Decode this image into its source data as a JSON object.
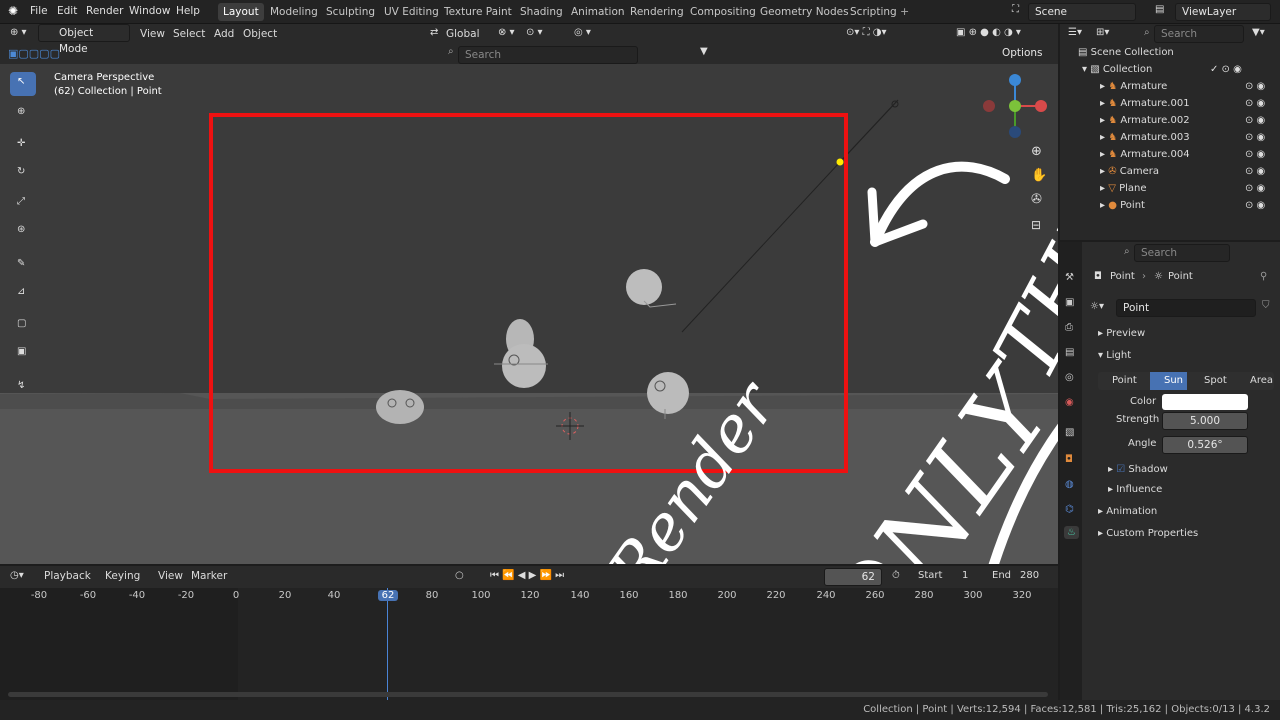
{
  "menus": [
    "File",
    "Edit",
    "Render",
    "Window",
    "Help"
  ],
  "workspaces": [
    "Layout",
    "Modeling",
    "Sculpting",
    "UV Editing",
    "Texture Paint",
    "Shading",
    "Animation",
    "Rendering",
    "Compositing",
    "Geometry Nodes",
    "Scripting"
  ],
  "active_workspace": "Layout",
  "scene": "Scene",
  "view_layer": "ViewLayer",
  "header": {
    "mode": "Object Mode",
    "view": "View",
    "select": "Select",
    "add": "Add",
    "object": "Object",
    "orientation": "Global",
    "search_placeholder": "Search",
    "options": "Options"
  },
  "viewport": {
    "title": "Camera Perspective",
    "subtitle": "(62) Collection | Point"
  },
  "annotation": {
    "text1": "Render",
    "text2": "ONLY",
    "text3": "THIS"
  },
  "outliner": {
    "search_placeholder": "Search",
    "scene_collection": "Scene Collection",
    "collection": "Collection",
    "items": [
      "Armature",
      "Armature.001",
      "Armature.002",
      "Armature.003",
      "Armature.004",
      "Camera",
      "Plane",
      "Point"
    ]
  },
  "properties": {
    "search_placeholder": "Search",
    "breadcrumb_obj": "Point",
    "breadcrumb_data": "Point",
    "datablock": "Point",
    "preview": "Preview",
    "light": "Light",
    "light_types": [
      "Point",
      "Sun",
      "Spot",
      "Area"
    ],
    "active_light_type": "Sun",
    "color_label": "Color",
    "strength_label": "Strength",
    "strength_value": "5.000",
    "angle_label": "Angle",
    "angle_value": "0.526°",
    "shadow": "Shadow",
    "influence": "Influence",
    "animation": "Animation",
    "custom_properties": "Custom Properties"
  },
  "timeline": {
    "playback": "Playback",
    "keying": "Keying",
    "view": "View",
    "marker": "Marker",
    "current_frame": "62",
    "start_label": "Start",
    "start": "1",
    "end_label": "End",
    "end": "280",
    "ticks": [
      "-80",
      "-60",
      "-40",
      "-20",
      "0",
      "20",
      "40",
      "62",
      "80",
      "100",
      "120",
      "140",
      "160",
      "180",
      "200",
      "220",
      "240",
      "260",
      "280",
      "300",
      "320"
    ]
  },
  "status": "Collection | Point | Verts:12,594 | Faces:12,581 | Tris:25,162 | Objects:0/13 | 4.3.2",
  "colors": {
    "accent": "#4772b3",
    "annotation": "#ffffff",
    "camera_frame": "#ee1111",
    "selected": "#f5a623"
  }
}
